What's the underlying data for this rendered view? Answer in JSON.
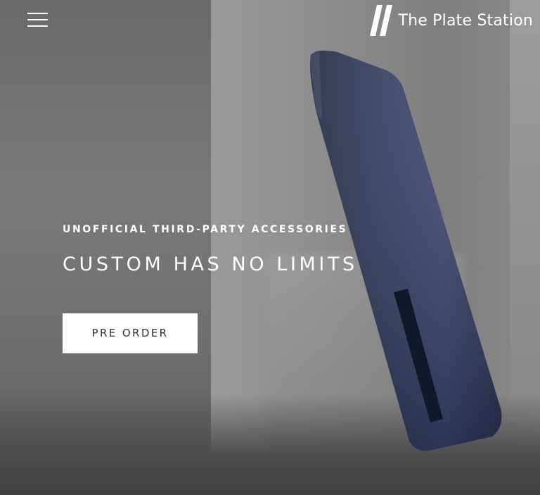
{
  "header": {
    "menu_icon": "hamburger-menu-icon",
    "brand_icon": "double-slash-logo-icon",
    "brand_name": "The Plate Station"
  },
  "hero": {
    "eyebrow": "UNOFFICIAL THIRD-PARTY ACCESSORIES",
    "headline": "CUSTOM HAS NO LIMITS",
    "cta_label": "PRE ORDER"
  },
  "colors": {
    "text": "#ffffff",
    "button_bg": "#ffffff",
    "button_text": "#333333",
    "product_plate": "#2c3553"
  }
}
